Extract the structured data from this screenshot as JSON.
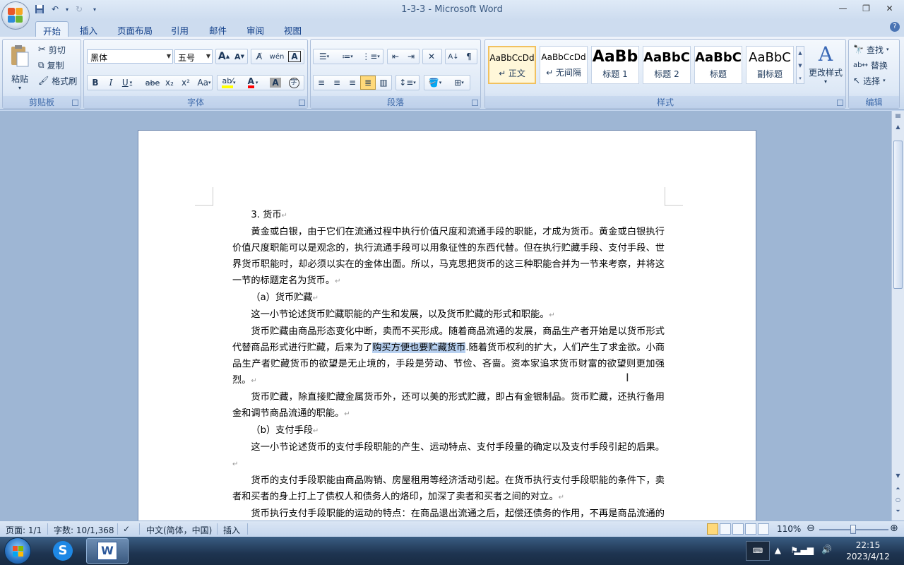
{
  "window": {
    "title": "1-3-3 - Microsoft Word"
  },
  "tabs": [
    "开始",
    "插入",
    "页面布局",
    "引用",
    "邮件",
    "审阅",
    "视图"
  ],
  "clipboard": {
    "paste_label": "粘贴",
    "cut_label": "剪切",
    "copy_label": "复制",
    "format_painter_label": "格式刷",
    "group_label": "剪贴板"
  },
  "font": {
    "font_name": "黑体",
    "font_size": "五号",
    "group_label": "字体",
    "bold": "B",
    "italic": "I",
    "underline": "U",
    "strike": "abe",
    "subscript": "x₂",
    "superscript": "x²",
    "change_case": "Aa",
    "grow": "A",
    "shrink": "A",
    "pinyin": "wén",
    "highlight_color": "#ffff00",
    "font_color": "#ff0000"
  },
  "paragraph": {
    "group_label": "段落"
  },
  "styles": {
    "group_label": "样式",
    "items": [
      {
        "sample": "AaBbCcDd",
        "name": "↵ 正文"
      },
      {
        "sample": "AaBbCcDd",
        "name": "↵ 无间隔"
      },
      {
        "sample": "AaBb",
        "name": "标题 1"
      },
      {
        "sample": "AaBbC",
        "name": "标题 2"
      },
      {
        "sample": "AaBbC",
        "name": "标题"
      },
      {
        "sample": "AaBbC",
        "name": "副标题"
      }
    ],
    "change_styles_label": "更改样式"
  },
  "editing": {
    "group_label": "编辑",
    "find_label": "查找",
    "replace_label": "替换",
    "select_label": "选择"
  },
  "document": {
    "paragraphs": [
      {
        "text": "3. 货币",
        "indent": true
      },
      {
        "text": "黄金或白银，由于它们在流通过程中执行价值尺度和流通手段的职能，才成为货币。黄金或白银执行价值尺度职能可以是观念的，执行流通手段可以用象征性的东西代替。但在执行贮藏手段、支付手段、世界货币职能时，却必须以实在的金体出面。所以，马克思把货币的这三种职能合并为一节来考察，并将这一节的标题定名为货币。",
        "indent": true
      },
      {
        "text": "（a）货币贮藏",
        "indent": true
      },
      {
        "text": "这一小节论述货币贮藏职能的产生和发展，以及货币贮藏的形式和职能。",
        "indent": true
      },
      {
        "text_before": "货币贮藏由商品形态变化中断，卖而不买形成。随着商品流通的发展，商品生产者开始是以货币形式代替商品形式进行贮藏，后来为了",
        "highlight": "购买方便也要贮藏货币",
        "text_after": ".随着货币权利的扩大，人们产生了求金欲。小商品生产者贮藏货币的欲望是无止境的，手段是劳动、节俭、吝啬。资本家追求货币财富的欲望则更加强烈。",
        "indent": true
      },
      {
        "text": "货币贮藏，除直接贮藏金属货币外，还可以美的形式贮藏，即占有金银制品。货币贮藏，还执行备用金和调节商品流通的职能。",
        "indent": true
      },
      {
        "text": "（b）支付手段",
        "indent": true
      },
      {
        "text": "这一小节论述货币的支付手段职能的产生、运动特点、支付手段量的确定以及支付手段引起的后果。",
        "indent": true
      },
      {
        "text": "货币的支付手段职能由商品购销、房屋租用等经济活动引起。在货币执行支付手段职能的条件下，卖者和买者的身上打上了债权人和债务人的烙印，加深了卖者和买者之间的对立。",
        "indent": true
      },
      {
        "text": "货币执行支付手段职能的运动的特点：在商品退出流通之后，起偿还债务的作用，不再是商品流通的媒介，而是作为绝对的财富，独立地结束商品流通过程。",
        "indent": true
      }
    ]
  },
  "status": {
    "page": "页面: 1/1",
    "words": "字数: 10/1,368",
    "language": "中文(简体，中国)",
    "mode": "插入",
    "zoom": "110%"
  },
  "taskbar": {
    "time": "22:15",
    "date": "2023/4/12"
  }
}
